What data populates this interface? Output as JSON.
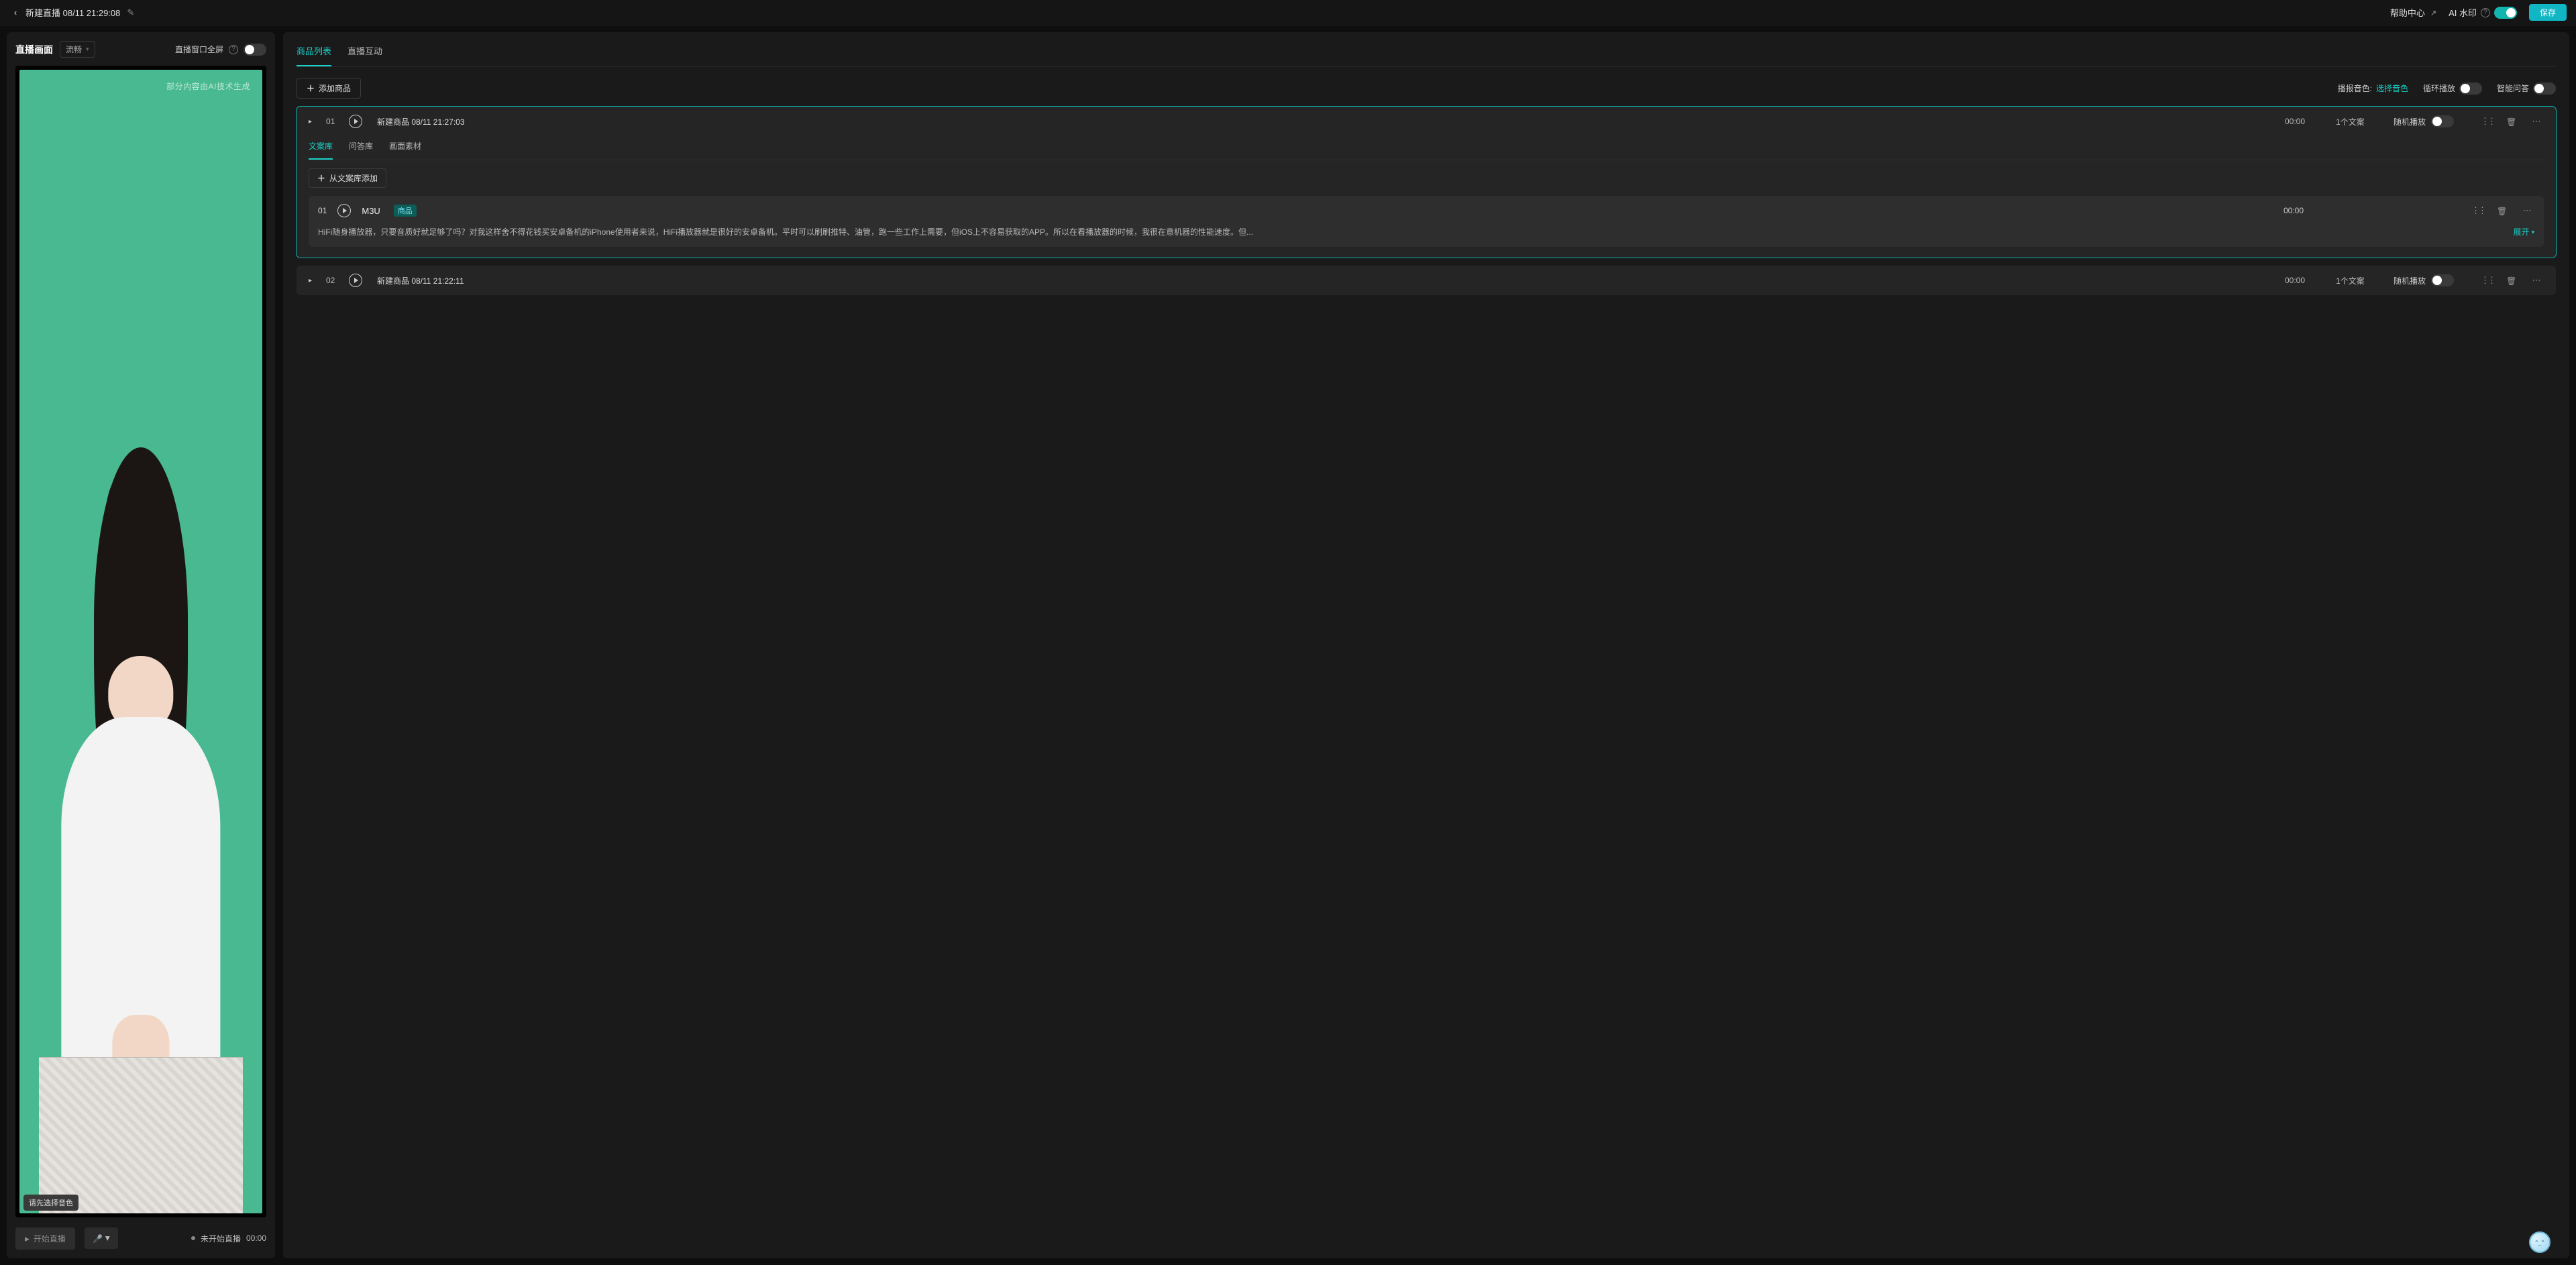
{
  "header": {
    "title": "新建直播 08/11 21:29:08",
    "help": "帮助中心",
    "watermark": "AI 水印",
    "watermark_on": true,
    "save": "保存"
  },
  "left": {
    "title": "直播画面",
    "quality": "流畅",
    "fullscreen_label": "直播窗口全屏",
    "fullscreen_on": false,
    "ai_generated_notice": "部分内容由AI技术生成",
    "tooltip": "请先选择音色",
    "start_button": "开始直播",
    "status_label": "未开始直播",
    "status_time": "00:00"
  },
  "right": {
    "tabs": [
      "商品列表",
      "直播互动"
    ],
    "active_tab": 0,
    "add_product": "添加商品",
    "voice_label": "播报音色:",
    "voice_value": "选择音色",
    "loop_label": "循环播放",
    "loop_on": false,
    "smart_qa_label": "智能问答",
    "smart_qa_on": false
  },
  "sub_tabs": [
    "文案库",
    "问答库",
    "画面素材"
  ],
  "sub_tab_active": 0,
  "add_from_lib": "从文案库添加",
  "shuffle_label": "随机播放",
  "expand_label": "展开",
  "products": [
    {
      "index": "01",
      "title": "新建商品 08/11 21:27:03",
      "time": "00:00",
      "script_count": "1个文案",
      "shuffle_on": false,
      "expanded": true,
      "scripts": [
        {
          "index": "01",
          "title": "M3U",
          "tag": "商品",
          "time": "00:00",
          "text": "HiFi随身播放器，只要音质好就足够了吗？对我这样舍不得花钱买安卓备机的iPhone使用者来说，HiFi播放器就是很好的安卓备机。平时可以刷刷推特、油管，跑一些工作上需要，但iOS上不容易获取的APP。所以在看播放器的时候，我很在意机器的性能速度。但..."
        }
      ]
    },
    {
      "index": "02",
      "title": "新建商品 08/11 21:22:11",
      "time": "00:00",
      "script_count": "1个文案",
      "shuffle_on": false,
      "expanded": false
    }
  ]
}
